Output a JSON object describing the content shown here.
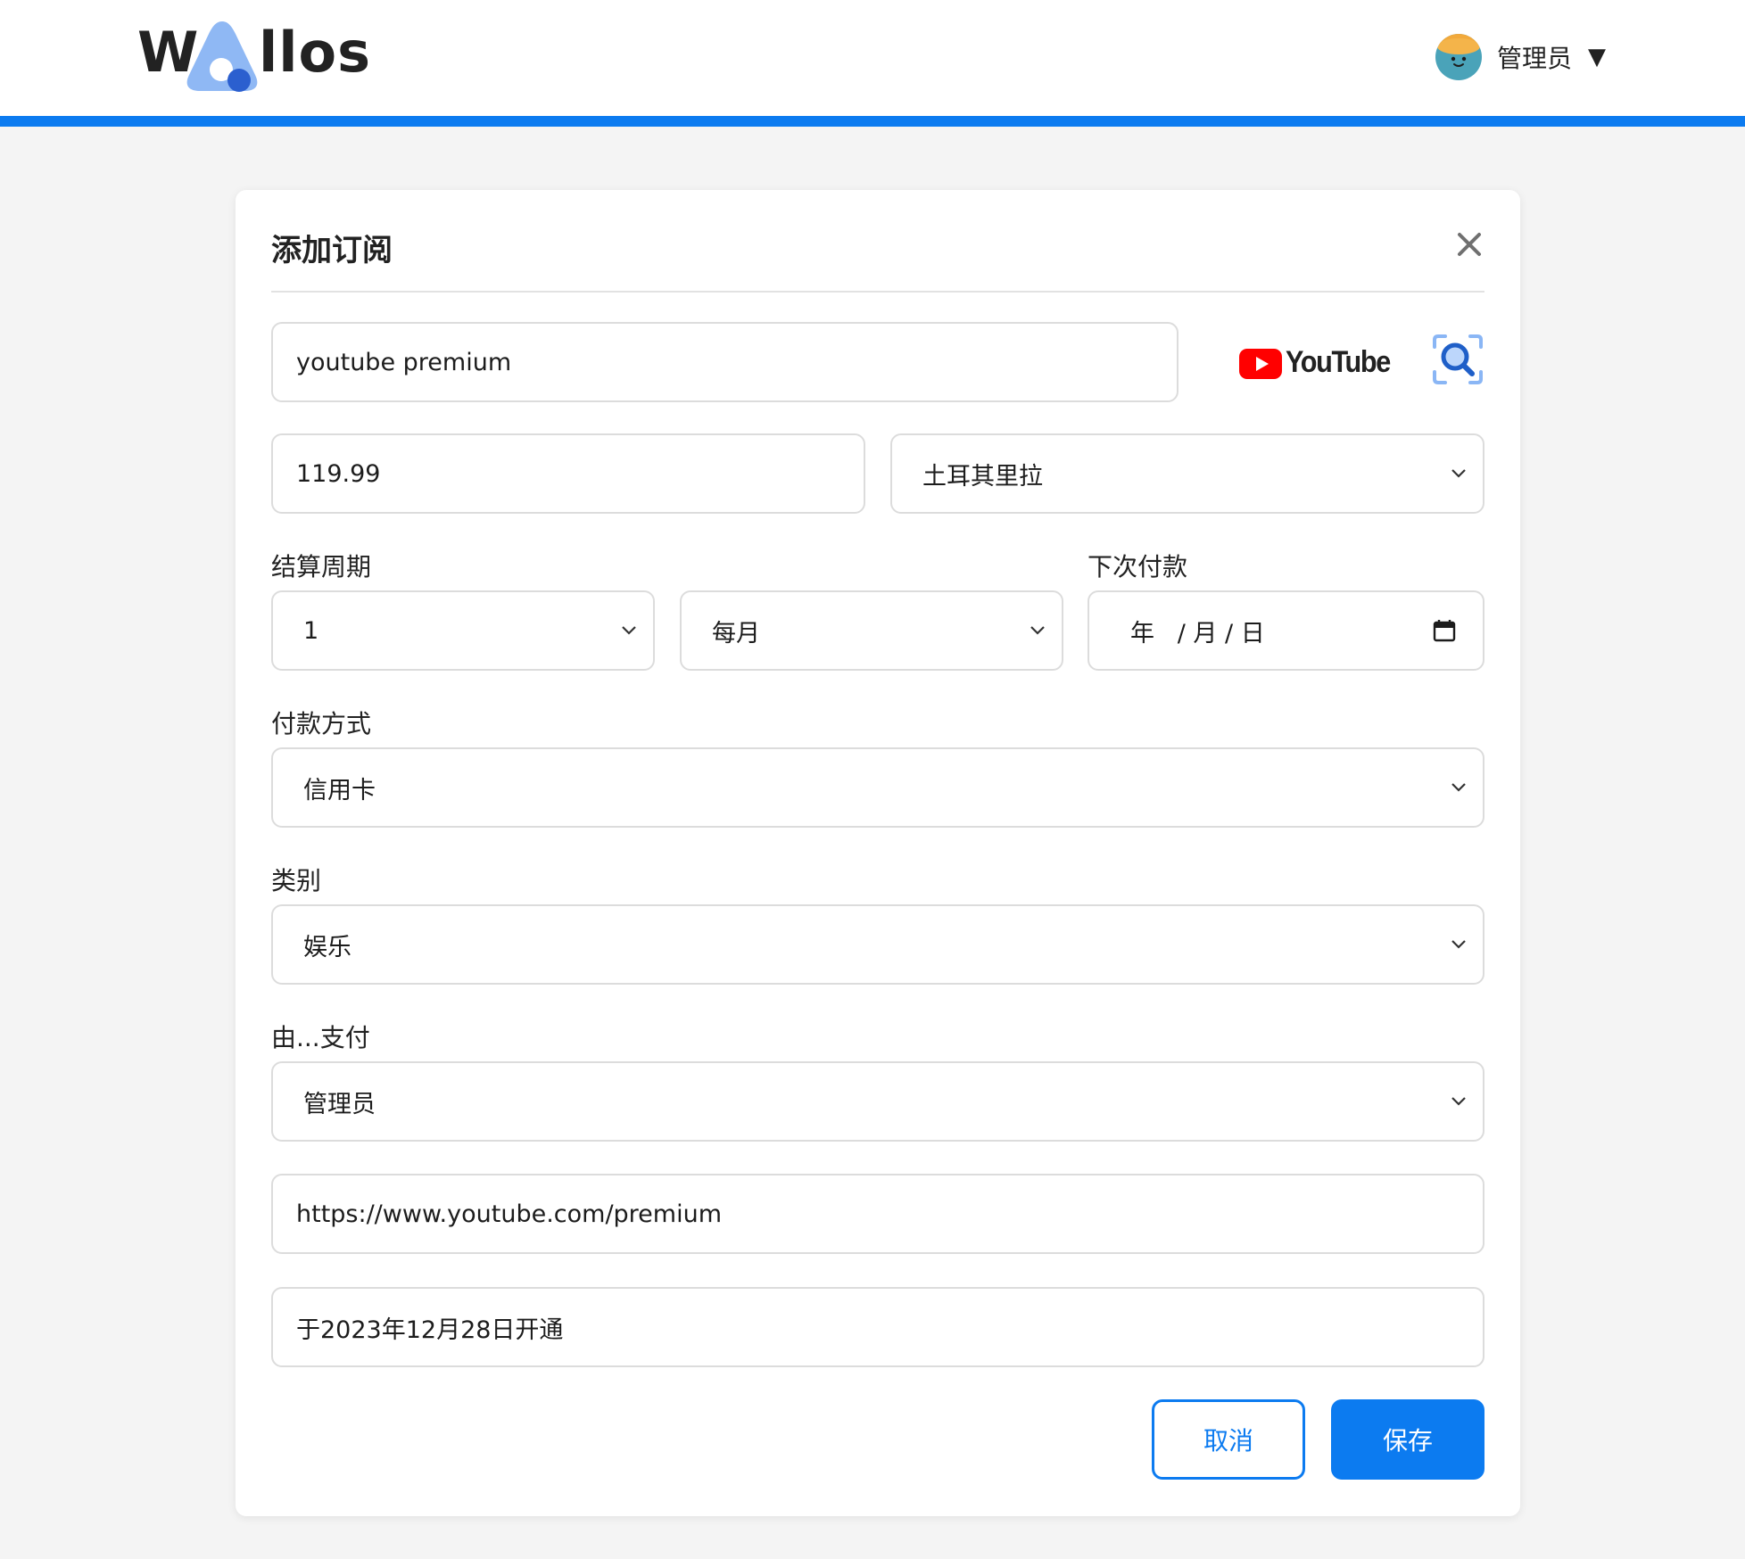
{
  "header": {
    "logo_left": "W",
    "logo_right": "llos",
    "user_name": "管理员",
    "caret": "▼"
  },
  "modal": {
    "title": "添加订阅",
    "name_value": "youtube premium",
    "logo_preview_text": "YouTube",
    "price_value": "119.99",
    "currency": "土耳其里拉",
    "billing_cycle_label": "结算周期",
    "cycle_count": "1",
    "cycle_unit": "每月",
    "next_payment_label": "下次付款",
    "next_payment_placeholder": "年   / 月 / 日",
    "payment_method_label": "付款方式",
    "payment_method": "信用卡",
    "category_label": "类别",
    "category": "娱乐",
    "payer_label": "由...支付",
    "payer": "管理员",
    "url_value": "https://www.youtube.com/premium",
    "notes_value": "于2023年12月28日开通",
    "cancel_label": "取消",
    "save_label": "保存"
  },
  "colors": {
    "accent": "#0c7bf0",
    "youtube_red": "#ff0000",
    "page_background": "#f4f4f4"
  },
  "icons": {
    "close": "close-icon",
    "search_logo": "search-logo-icon",
    "calendar": "calendar-icon",
    "chevron": "chevron-down-icon"
  }
}
